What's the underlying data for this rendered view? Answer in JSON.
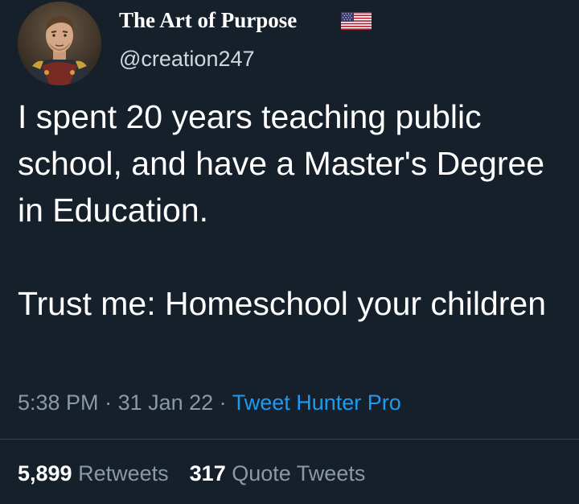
{
  "author": {
    "display_name": "The Art of Purpose",
    "handle": "@creation247",
    "flag_icon": "us-flag-icon",
    "avatar_icon": "profile-avatar"
  },
  "tweet": {
    "paragraph_1": "I spent 20 years teaching public school, and have a Master's Degree in Education.",
    "paragraph_2": "Trust me: Homeschool your children"
  },
  "meta": {
    "time": "5:38 PM",
    "separator": " · ",
    "date": "31 Jan 22",
    "source": "Tweet Hunter Pro"
  },
  "stats": {
    "retweets_count": "5,899",
    "retweets_label": "Retweets",
    "quotes_count": "317",
    "quotes_label": "Quote Tweets"
  },
  "colors": {
    "background": "#15202b",
    "link": "#1d9bf0",
    "muted": "#8b98a5",
    "divider": "#38444d"
  }
}
